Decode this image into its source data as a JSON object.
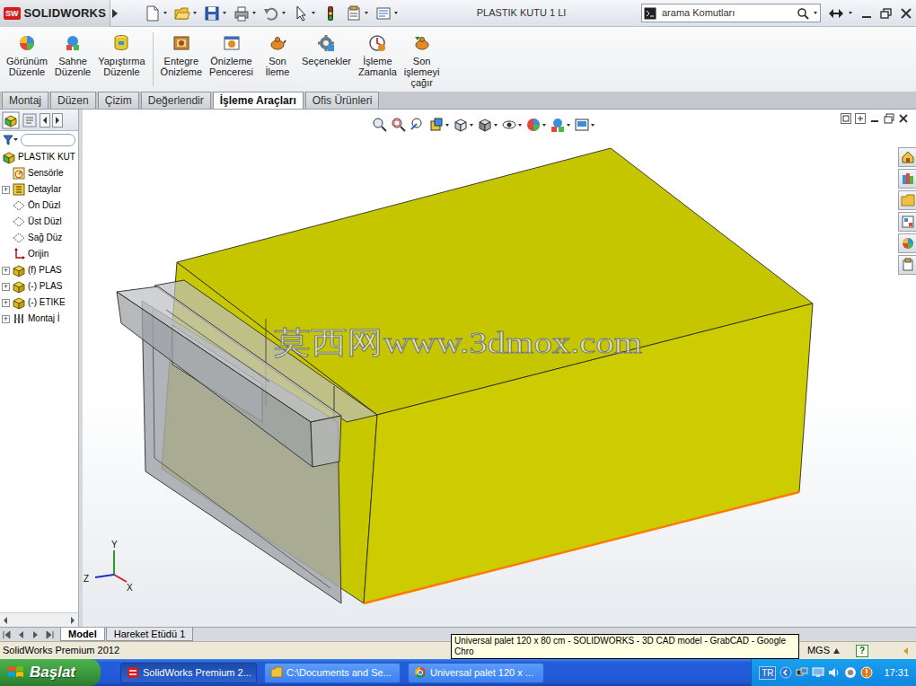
{
  "window": {
    "logo": "SW",
    "app": "SOLIDWORKS",
    "title": "PLASTIK KUTU 1 LI"
  },
  "search": {
    "placeholder": "arama Komutları"
  },
  "ribbon": [
    [
      "Görünüm Düzenle",
      "Sahne Düzenle",
      "Yapıştırma Düzenle"
    ],
    [
      "Entegre Önizleme",
      "Önizleme Penceresi",
      "Son İleme",
      "Seçenekler",
      "İşleme Zamanla",
      "Son işlemeyi çağır"
    ]
  ],
  "tabs": [
    {
      "label": "Montaj",
      "selected": false
    },
    {
      "label": "Düzen",
      "selected": false
    },
    {
      "label": "Çizim",
      "selected": false
    },
    {
      "label": "Değerlendir",
      "selected": false
    },
    {
      "label": "İşleme Araçları",
      "selected": true
    },
    {
      "label": "Ofis Ürünleri",
      "selected": false
    }
  ],
  "tree": [
    {
      "label": "PLASTIK KUT",
      "kind": "assembly"
    },
    {
      "label": "Sensörle",
      "kind": "sensor"
    },
    {
      "label": "Detaylar",
      "kind": "annotation",
      "toggle": "+",
      "expanded": false
    },
    {
      "label": "Ön Düzl",
      "kind": "plane"
    },
    {
      "label": "Üst Düzl",
      "kind": "plane"
    },
    {
      "label": "Sağ Düz",
      "kind": "plane"
    },
    {
      "label": "Orijin",
      "kind": "origin"
    },
    {
      "label": "(f) PLAS",
      "kind": "part",
      "toggle": "+",
      "expanded": false
    },
    {
      "label": "(-) PLAS",
      "kind": "part",
      "toggle": "+",
      "expanded": false
    },
    {
      "label": "(-) ETIKE",
      "kind": "part",
      "toggle": "+",
      "expanded": false
    },
    {
      "label": "Montaj İ",
      "kind": "mates",
      "toggle": "+",
      "expanded": false
    }
  ],
  "viewport": {
    "watermark": "莫西网www.3dmox.com",
    "triad": {
      "y": "Y",
      "z": "Z",
      "x": "X"
    }
  },
  "model_tabs": [
    {
      "label": "Model",
      "selected": true
    },
    {
      "label": "Hareket Etüdü 1",
      "selected": false
    }
  ],
  "status_bar": {
    "product": "SolidWorks Premium 2012",
    "units": "MGS",
    "help": "?"
  },
  "tooltip": "Universal palet 120 x 80 cm - SOLIDWORKS - 3D CAD model - GrabCAD - Google Chro",
  "taskbar": {
    "start": "Başlat",
    "tasks": [
      {
        "label": "SolidWorks Premium 2...",
        "kind": "solidworks",
        "selected": true
      },
      {
        "label": "C:\\Documents and Se...",
        "kind": "folder",
        "selected": false
      },
      {
        "label": "Universal palet 120 x ...",
        "kind": "chrome",
        "selected": false
      }
    ],
    "language": "TR",
    "clock": "17:31"
  }
}
